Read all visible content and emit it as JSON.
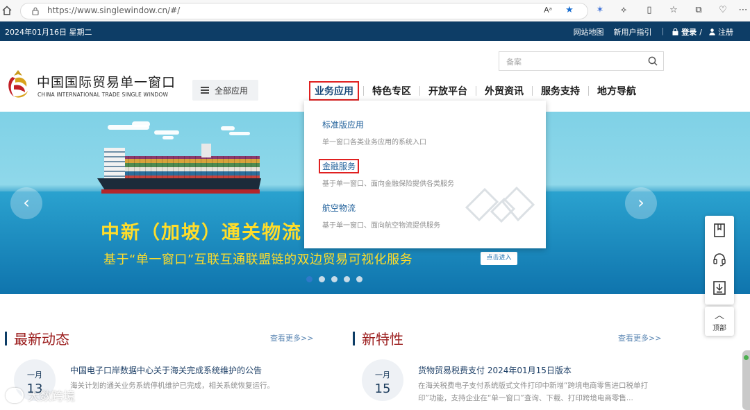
{
  "browser": {
    "url": "https://www.singlewindow.cn/#/"
  },
  "topbar": {
    "date": "2024年01月16日 星期二",
    "sitemap": "网站地图",
    "guide": "新用户指引",
    "login": "登录",
    "divider": "/",
    "register": "注册"
  },
  "header": {
    "logo_cn": "中国国际贸易单一窗口",
    "logo_en": "CHINA INTERNATIONAL TRADE SINGLE WINDOW",
    "all_apps": "全部应用",
    "search_placeholder": "备案",
    "nav": [
      {
        "label": "业务应用"
      },
      {
        "label": "特色专区"
      },
      {
        "label": "开放平台"
      },
      {
        "label": "外贸资讯"
      },
      {
        "label": "服务支持"
      },
      {
        "label": "地方导航"
      }
    ]
  },
  "dropdown": {
    "items": [
      {
        "title": "标准版应用",
        "desc": "单一窗口各类业务应用的系统入口"
      },
      {
        "title": "金融服务",
        "desc": "基于单一窗口、面向金融保险提供各类服务"
      },
      {
        "title": "航空物流",
        "desc": "基于单一窗口、面向航空物流提供服务"
      }
    ]
  },
  "banner": {
    "title": "中新（加坡）通关物流",
    "subtitle": "基于“单一窗口”互联互通联盟链的双边贸易可视化服务",
    "enter": "点击进入",
    "prev": "‹",
    "next": "›",
    "active_slide": 1,
    "slide_count": 5
  },
  "float_bar": {
    "top_label": "顶部"
  },
  "news_left": {
    "title": "最新动态",
    "more": "查看更多>>",
    "item": {
      "month": "一月",
      "day": "13",
      "title": "中国电子口岸数据中心关于海关完成系统维护的公告",
      "desc": "海关计划的通关业务系统停机维护已完成，相关系统恢复运行。"
    }
  },
  "news_right": {
    "title": "新特性",
    "more": "查看更多>>",
    "item": {
      "month": "一月",
      "day": "15",
      "title": "货物贸易税费支付 2024年01月15日版本",
      "desc": "在海关税费电子支付系统版式文件打印中新增“跨境电商零售进口税单打印”功能，支持企业在“单一窗口”查询、下载、打印跨境电商零售..."
    }
  },
  "watermark": {
    "text": "大数跨境"
  },
  "colors": {
    "top_strip": "#0d3d66",
    "banner_text": "#ffdd2a",
    "section_title": "#9b1c1c",
    "highlight_box": "#e02020"
  }
}
